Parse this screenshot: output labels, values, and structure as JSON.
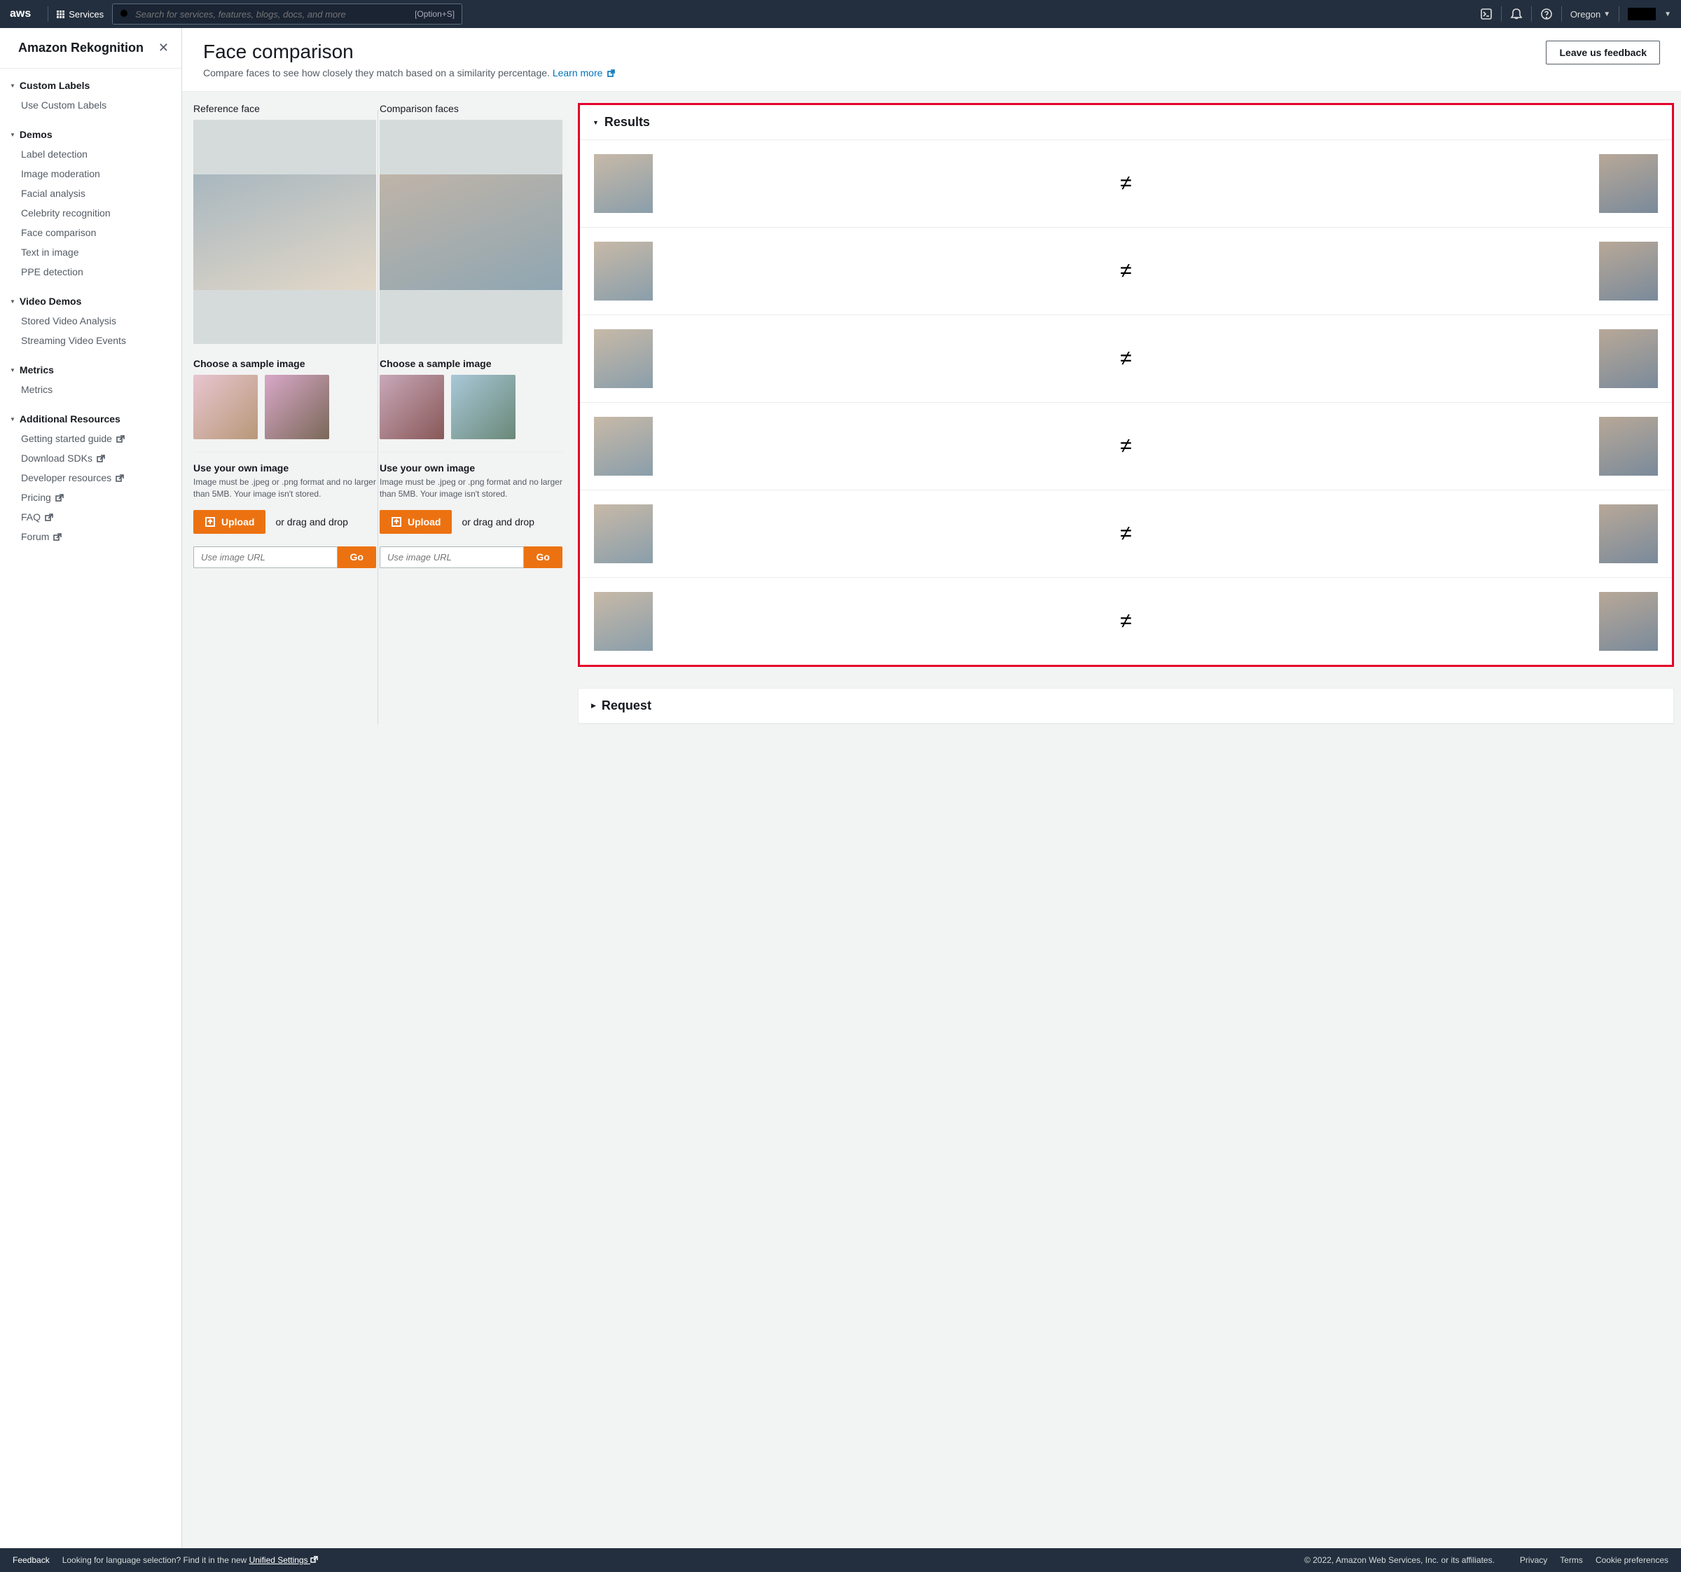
{
  "topnav": {
    "logo_text": "aws",
    "services_label": "Services",
    "search_placeholder": "Search for services, features, blogs, docs, and more",
    "search_shortcut": "[Option+S]",
    "region": "Oregon"
  },
  "sidebar": {
    "title": "Amazon Rekognition",
    "sections": [
      {
        "title": "Custom Labels",
        "items": [
          {
            "label": "Use Custom Labels"
          }
        ]
      },
      {
        "title": "Demos",
        "items": [
          {
            "label": "Label detection"
          },
          {
            "label": "Image moderation"
          },
          {
            "label": "Facial analysis"
          },
          {
            "label": "Celebrity recognition"
          },
          {
            "label": "Face comparison"
          },
          {
            "label": "Text in image"
          },
          {
            "label": "PPE detection"
          }
        ]
      },
      {
        "title": "Video Demos",
        "items": [
          {
            "label": "Stored Video Analysis"
          },
          {
            "label": "Streaming Video Events"
          }
        ]
      },
      {
        "title": "Metrics",
        "items": [
          {
            "label": "Metrics"
          }
        ]
      },
      {
        "title": "Additional Resources",
        "items": [
          {
            "label": "Getting started guide",
            "ext": true
          },
          {
            "label": "Download SDKs",
            "ext": true
          },
          {
            "label": "Developer resources",
            "ext": true
          },
          {
            "label": "Pricing",
            "ext": true
          },
          {
            "label": "FAQ",
            "ext": true
          },
          {
            "label": "Forum",
            "ext": true
          }
        ]
      }
    ]
  },
  "page": {
    "title": "Face comparison",
    "description": "Compare faces to see how closely they match based on a similarity percentage.",
    "learn_more": "Learn more",
    "feedback_button": "Leave us feedback"
  },
  "uploads": {
    "reference": {
      "label": "Reference face",
      "sample_label": "Choose a sample image",
      "own_label": "Use your own image",
      "hint": "Image must be .jpeg or .png format and no larger than 5MB. Your image isn't stored.",
      "upload_btn": "Upload",
      "dragdrop": "or drag and drop",
      "url_placeholder": "Use image URL",
      "go_btn": "Go"
    },
    "comparison": {
      "label": "Comparison faces",
      "sample_label": "Choose a sample image",
      "own_label": "Use your own image",
      "hint": "Image must be .jpeg or .png format and no larger than 5MB. Your image isn't stored.",
      "upload_btn": "Upload",
      "dragdrop": "or drag and drop",
      "url_placeholder": "Use image URL",
      "go_btn": "Go"
    }
  },
  "results": {
    "title": "Results",
    "rows": [
      {
        "match": false
      },
      {
        "match": false
      },
      {
        "match": false
      },
      {
        "match": false
      },
      {
        "match": false
      },
      {
        "match": false
      }
    ]
  },
  "request": {
    "title": "Request"
  },
  "footer": {
    "feedback": "Feedback",
    "lang_hint": "Looking for language selection? Find it in the new",
    "unified": "Unified Settings",
    "copyright": "© 2022, Amazon Web Services, Inc. or its affiliates.",
    "links": [
      "Privacy",
      "Terms",
      "Cookie preferences"
    ]
  }
}
